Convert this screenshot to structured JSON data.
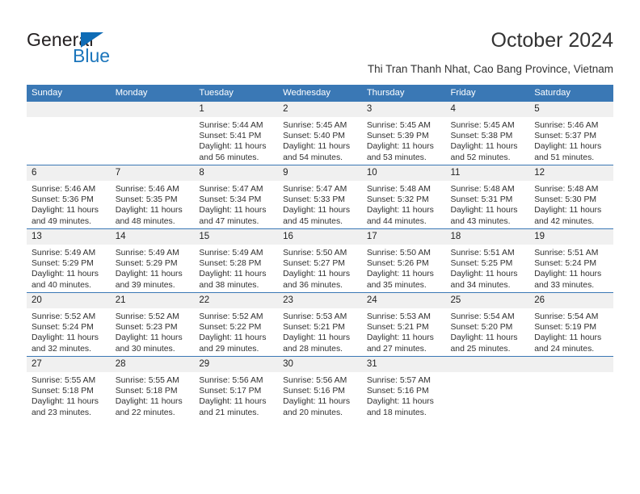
{
  "brand": {
    "line1": "General",
    "line2": "Blue",
    "triangle_color": "#0f6cb6",
    "blue_text_color": "#1b75bb"
  },
  "header": {
    "month_title": "October 2024",
    "location": "Thi Tran Thanh Nhat, Cao Bang Province, Vietnam",
    "header_bg_color": "#3a78b5",
    "daynum_bg_color": "#f0f0f0"
  },
  "weekday_headers": [
    "Sunday",
    "Monday",
    "Tuesday",
    "Wednesday",
    "Thursday",
    "Friday",
    "Saturday"
  ],
  "weeks": [
    [
      {
        "day": "",
        "empty": true
      },
      {
        "day": "",
        "empty": true
      },
      {
        "day": "1",
        "sunrise": "Sunrise: 5:44 AM",
        "sunset": "Sunset: 5:41 PM",
        "daylight": "Daylight: 11 hours and 56 minutes."
      },
      {
        "day": "2",
        "sunrise": "Sunrise: 5:45 AM",
        "sunset": "Sunset: 5:40 PM",
        "daylight": "Daylight: 11 hours and 54 minutes."
      },
      {
        "day": "3",
        "sunrise": "Sunrise: 5:45 AM",
        "sunset": "Sunset: 5:39 PM",
        "daylight": "Daylight: 11 hours and 53 minutes."
      },
      {
        "day": "4",
        "sunrise": "Sunrise: 5:45 AM",
        "sunset": "Sunset: 5:38 PM",
        "daylight": "Daylight: 11 hours and 52 minutes."
      },
      {
        "day": "5",
        "sunrise": "Sunrise: 5:46 AM",
        "sunset": "Sunset: 5:37 PM",
        "daylight": "Daylight: 11 hours and 51 minutes."
      }
    ],
    [
      {
        "day": "6",
        "sunrise": "Sunrise: 5:46 AM",
        "sunset": "Sunset: 5:36 PM",
        "daylight": "Daylight: 11 hours and 49 minutes."
      },
      {
        "day": "7",
        "sunrise": "Sunrise: 5:46 AM",
        "sunset": "Sunset: 5:35 PM",
        "daylight": "Daylight: 11 hours and 48 minutes."
      },
      {
        "day": "8",
        "sunrise": "Sunrise: 5:47 AM",
        "sunset": "Sunset: 5:34 PM",
        "daylight": "Daylight: 11 hours and 47 minutes."
      },
      {
        "day": "9",
        "sunrise": "Sunrise: 5:47 AM",
        "sunset": "Sunset: 5:33 PM",
        "daylight": "Daylight: 11 hours and 45 minutes."
      },
      {
        "day": "10",
        "sunrise": "Sunrise: 5:48 AM",
        "sunset": "Sunset: 5:32 PM",
        "daylight": "Daylight: 11 hours and 44 minutes."
      },
      {
        "day": "11",
        "sunrise": "Sunrise: 5:48 AM",
        "sunset": "Sunset: 5:31 PM",
        "daylight": "Daylight: 11 hours and 43 minutes."
      },
      {
        "day": "12",
        "sunrise": "Sunrise: 5:48 AM",
        "sunset": "Sunset: 5:30 PM",
        "daylight": "Daylight: 11 hours and 42 minutes."
      }
    ],
    [
      {
        "day": "13",
        "sunrise": "Sunrise: 5:49 AM",
        "sunset": "Sunset: 5:29 PM",
        "daylight": "Daylight: 11 hours and 40 minutes."
      },
      {
        "day": "14",
        "sunrise": "Sunrise: 5:49 AM",
        "sunset": "Sunset: 5:29 PM",
        "daylight": "Daylight: 11 hours and 39 minutes."
      },
      {
        "day": "15",
        "sunrise": "Sunrise: 5:49 AM",
        "sunset": "Sunset: 5:28 PM",
        "daylight": "Daylight: 11 hours and 38 minutes."
      },
      {
        "day": "16",
        "sunrise": "Sunrise: 5:50 AM",
        "sunset": "Sunset: 5:27 PM",
        "daylight": "Daylight: 11 hours and 36 minutes."
      },
      {
        "day": "17",
        "sunrise": "Sunrise: 5:50 AM",
        "sunset": "Sunset: 5:26 PM",
        "daylight": "Daylight: 11 hours and 35 minutes."
      },
      {
        "day": "18",
        "sunrise": "Sunrise: 5:51 AM",
        "sunset": "Sunset: 5:25 PM",
        "daylight": "Daylight: 11 hours and 34 minutes."
      },
      {
        "day": "19",
        "sunrise": "Sunrise: 5:51 AM",
        "sunset": "Sunset: 5:24 PM",
        "daylight": "Daylight: 11 hours and 33 minutes."
      }
    ],
    [
      {
        "day": "20",
        "sunrise": "Sunrise: 5:52 AM",
        "sunset": "Sunset: 5:24 PM",
        "daylight": "Daylight: 11 hours and 32 minutes."
      },
      {
        "day": "21",
        "sunrise": "Sunrise: 5:52 AM",
        "sunset": "Sunset: 5:23 PM",
        "daylight": "Daylight: 11 hours and 30 minutes."
      },
      {
        "day": "22",
        "sunrise": "Sunrise: 5:52 AM",
        "sunset": "Sunset: 5:22 PM",
        "daylight": "Daylight: 11 hours and 29 minutes."
      },
      {
        "day": "23",
        "sunrise": "Sunrise: 5:53 AM",
        "sunset": "Sunset: 5:21 PM",
        "daylight": "Daylight: 11 hours and 28 minutes."
      },
      {
        "day": "24",
        "sunrise": "Sunrise: 5:53 AM",
        "sunset": "Sunset: 5:21 PM",
        "daylight": "Daylight: 11 hours and 27 minutes."
      },
      {
        "day": "25",
        "sunrise": "Sunrise: 5:54 AM",
        "sunset": "Sunset: 5:20 PM",
        "daylight": "Daylight: 11 hours and 25 minutes."
      },
      {
        "day": "26",
        "sunrise": "Sunrise: 5:54 AM",
        "sunset": "Sunset: 5:19 PM",
        "daylight": "Daylight: 11 hours and 24 minutes."
      }
    ],
    [
      {
        "day": "27",
        "sunrise": "Sunrise: 5:55 AM",
        "sunset": "Sunset: 5:18 PM",
        "daylight": "Daylight: 11 hours and 23 minutes."
      },
      {
        "day": "28",
        "sunrise": "Sunrise: 5:55 AM",
        "sunset": "Sunset: 5:18 PM",
        "daylight": "Daylight: 11 hours and 22 minutes."
      },
      {
        "day": "29",
        "sunrise": "Sunrise: 5:56 AM",
        "sunset": "Sunset: 5:17 PM",
        "daylight": "Daylight: 11 hours and 21 minutes."
      },
      {
        "day": "30",
        "sunrise": "Sunrise: 5:56 AM",
        "sunset": "Sunset: 5:16 PM",
        "daylight": "Daylight: 11 hours and 20 minutes."
      },
      {
        "day": "31",
        "sunrise": "Sunrise: 5:57 AM",
        "sunset": "Sunset: 5:16 PM",
        "daylight": "Daylight: 11 hours and 18 minutes."
      },
      {
        "day": "",
        "empty": true
      },
      {
        "day": "",
        "empty": true
      }
    ]
  ]
}
